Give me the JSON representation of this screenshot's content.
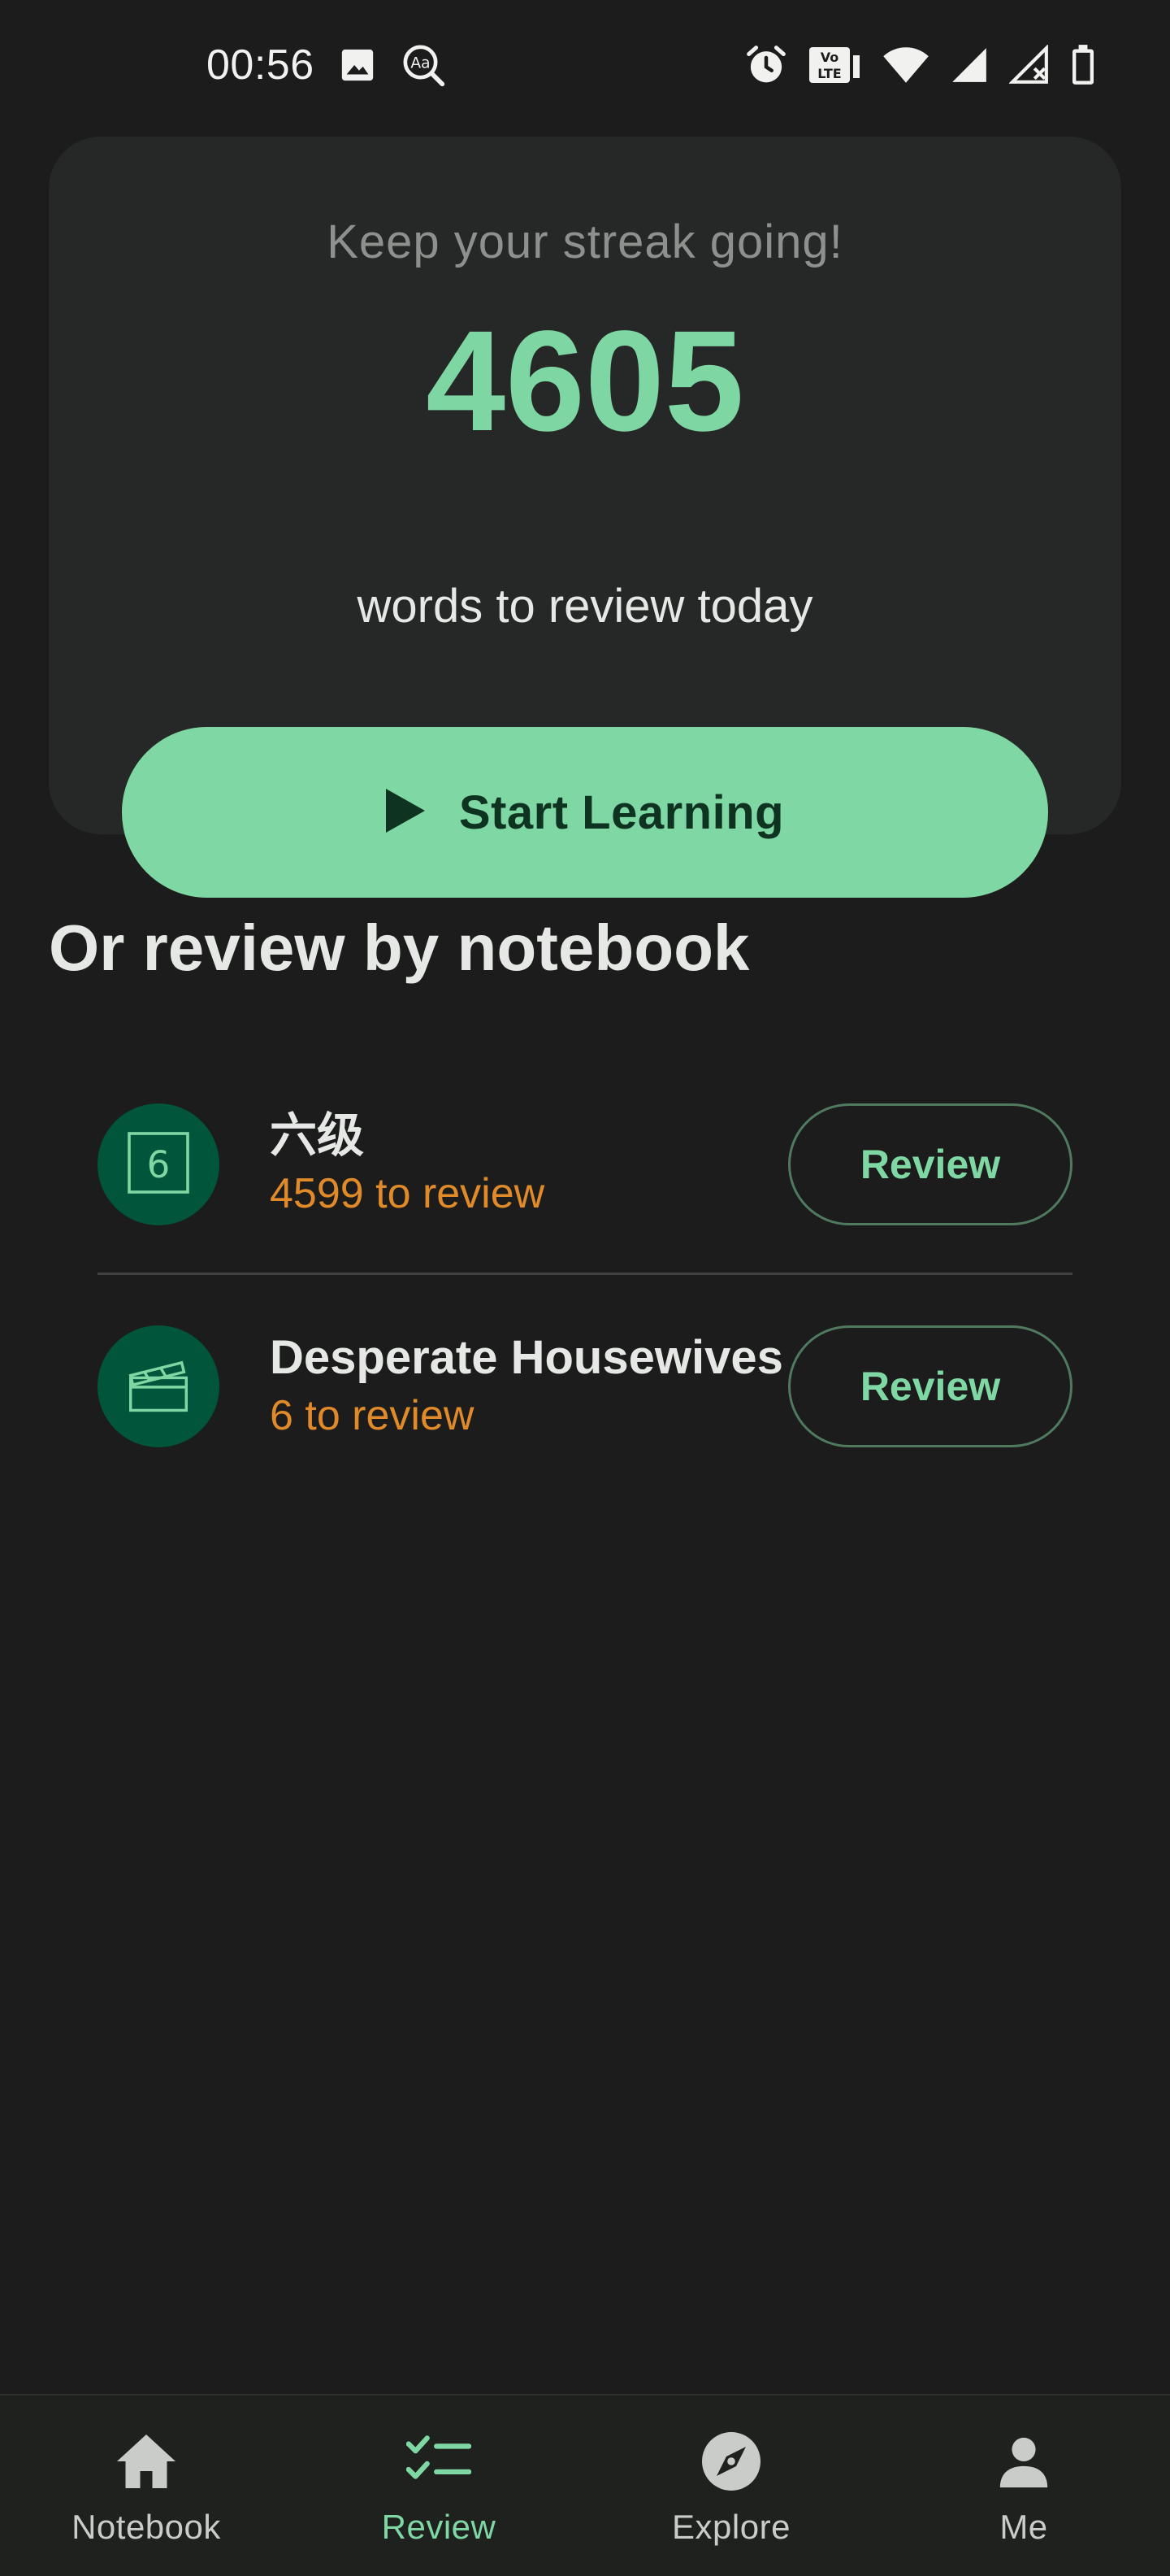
{
  "status_bar": {
    "time": "00:56",
    "left_icons": [
      "image-icon",
      "search-text-icon"
    ],
    "right_icons": [
      "alarm-icon",
      "volte-icon",
      "wifi-icon",
      "signal-icon",
      "signal-no-sim-icon",
      "battery-icon"
    ]
  },
  "streak_card": {
    "title": "Keep your streak going!",
    "count": "4605",
    "subtitle": "words to review today",
    "start_button_label": "Start Learning",
    "start_icon": "play-icon"
  },
  "section": {
    "title": "Or review by notebook"
  },
  "notebooks": [
    {
      "name": "六级",
      "count_text": "4599 to review",
      "icon": "number-six-icon",
      "button_label": "Review"
    },
    {
      "name": "Desperate Housewives",
      "count_text": "6 to review",
      "icon": "clapperboard-icon",
      "button_label": "Review"
    }
  ],
  "bottom_nav": {
    "items": [
      {
        "label": "Notebook",
        "icon": "home-icon",
        "active": false
      },
      {
        "label": "Review",
        "icon": "checklist-icon",
        "active": true
      },
      {
        "label": "Explore",
        "icon": "compass-icon",
        "active": false
      },
      {
        "label": "Me",
        "icon": "person-icon",
        "active": false
      }
    ]
  },
  "colors": {
    "accent": "#7fd8a3",
    "background": "#1b1c1b",
    "card": "#262827",
    "count_orange": "#e08a2a",
    "avatar_green": "#00553a"
  }
}
